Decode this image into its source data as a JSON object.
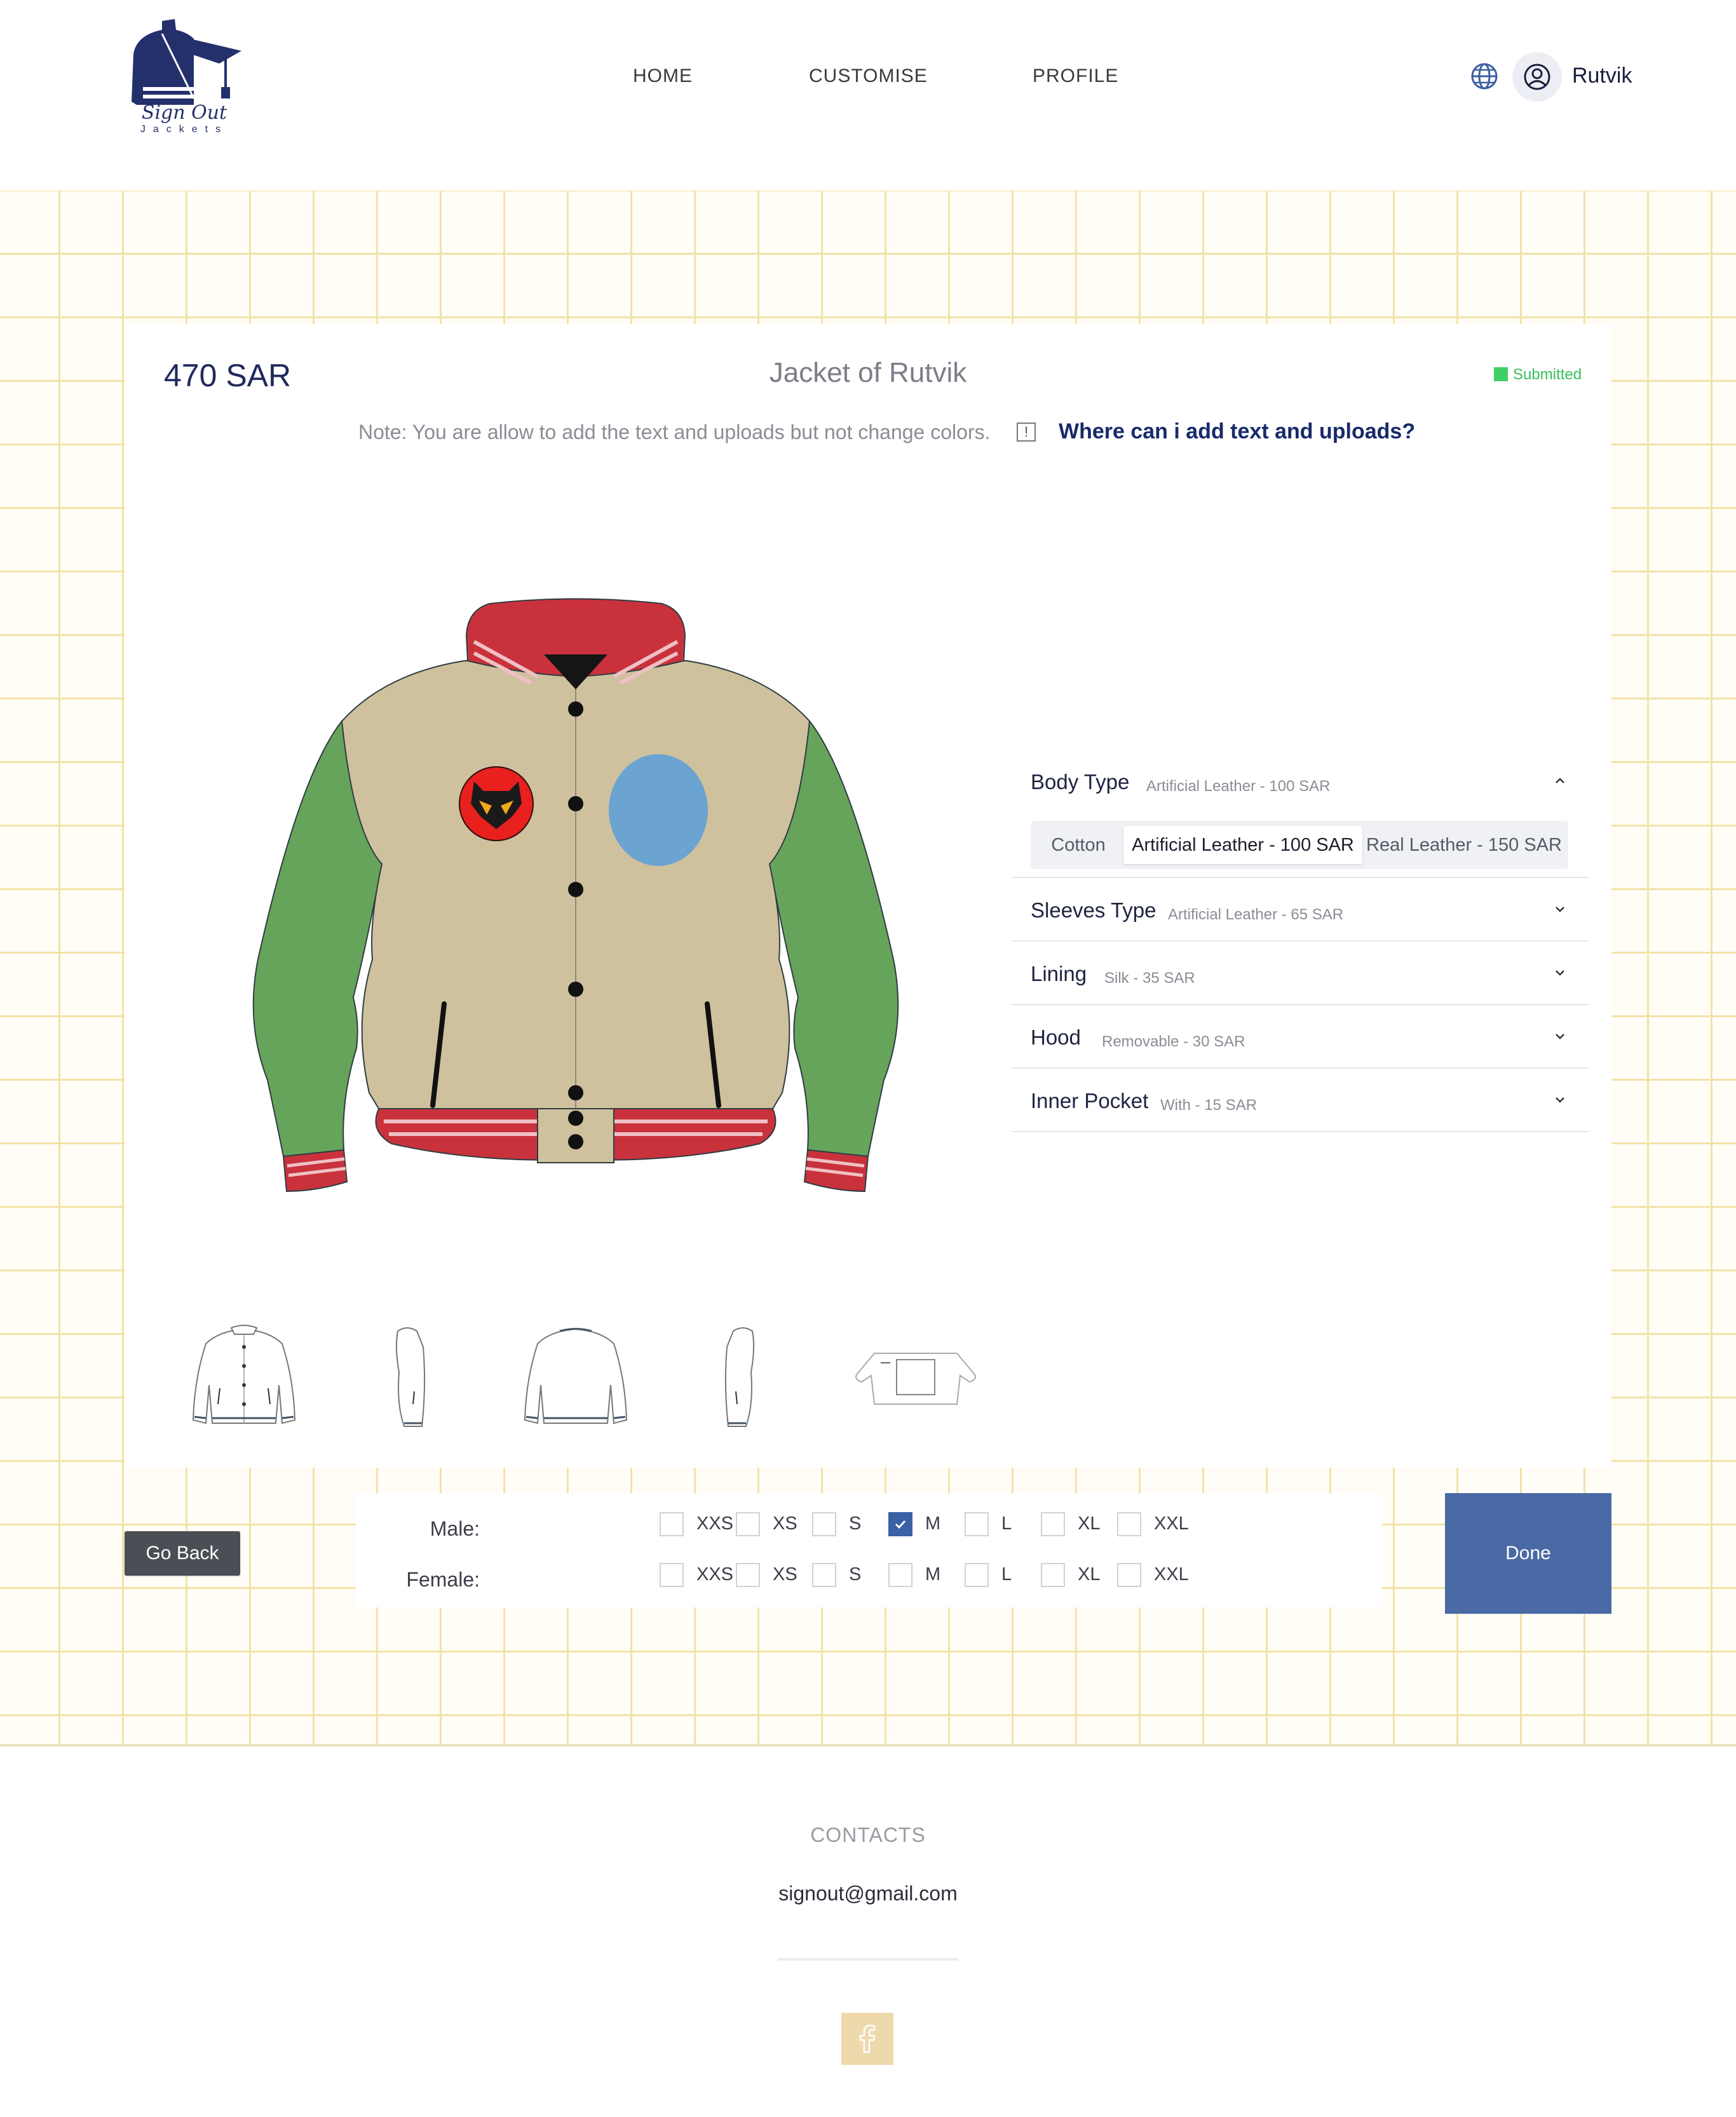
{
  "brand": {
    "name": "Sign Out",
    "sub": "Jackets",
    "color": "#24306b"
  },
  "nav": {
    "home": "HOME",
    "customise": "CUSTOMISE",
    "profile": "PROFILE"
  },
  "user": {
    "name": "Rutvik"
  },
  "jacket": {
    "price": "470 SAR",
    "title": "Jacket of Rutvik",
    "status": "Submitted",
    "note": "Note: You are allow to add the text and uploads but not change colors.",
    "note_icon": "!",
    "help_link": "Where can i add text and uploads?",
    "colors": {
      "body": "#cfc19d",
      "sleeves": "#67a45b",
      "trim": "#c9323c",
      "patch": "#6ba3d1"
    }
  },
  "options": [
    {
      "name": "Body Type",
      "value": "Artificial Leather - 100 SAR",
      "expanded": true,
      "choices": [
        "Cotton",
        "Artificial Leather - 100 SAR",
        "Real Leather - 150 SAR"
      ],
      "selected": 1
    },
    {
      "name": "Sleeves Type",
      "value": "Artificial Leather - 65 SAR",
      "expanded": false
    },
    {
      "name": "Lining",
      "value": "Silk - 35 SAR",
      "expanded": false
    },
    {
      "name": "Hood",
      "value": "Removable - 30 SAR",
      "expanded": false
    },
    {
      "name": "Inner Pocket",
      "value": "With - 15 SAR",
      "expanded": false
    }
  ],
  "sizes": {
    "male_label": "Male:",
    "female_label": "Female:",
    "list": [
      "XXS",
      "XS",
      "S",
      "M",
      "L",
      "XL",
      "XXL"
    ],
    "male_checked": "M",
    "female_checked": ""
  },
  "buttons": {
    "back": "Go Back",
    "done": "Done"
  },
  "footer": {
    "heading": "CONTACTS",
    "email": "signout@gmail.com"
  }
}
